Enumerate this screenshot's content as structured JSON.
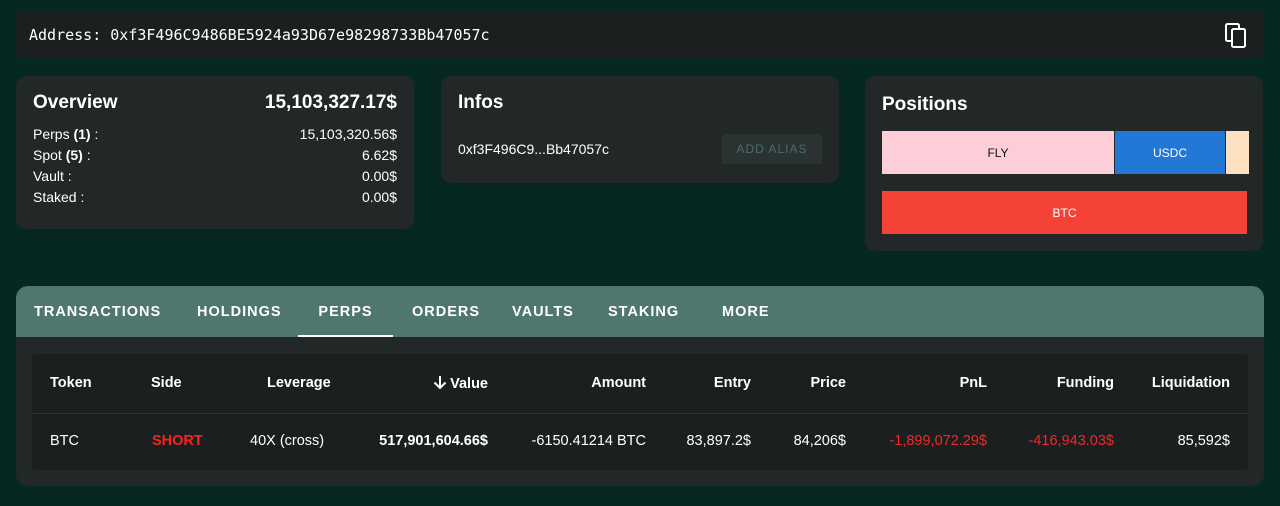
{
  "address": {
    "label": "Address:",
    "value": "0xf3F496C9486BE5924a93D67e98298733Bb47057c",
    "copy_icon": "copy-icon"
  },
  "overview": {
    "title": "Overview",
    "total": "15,103,327.17$",
    "rows": [
      {
        "label": "Perps",
        "count": "(1)",
        "suffix": " :",
        "value": "15,103,320.56$"
      },
      {
        "label": "Spot",
        "count": "(5)",
        "suffix": " :",
        "value": "6.62$"
      },
      {
        "label": "Vault :",
        "value": "0.00$"
      },
      {
        "label": "Staked :",
        "value": "0.00$"
      }
    ]
  },
  "infos": {
    "title": "Infos",
    "short_address": "0xf3F496C9...Bb47057c",
    "add_alias_label": "ADD ALIAS"
  },
  "positions": {
    "title": "Positions",
    "spot_segments": [
      {
        "label": "FLY",
        "color": "#fdcdd8"
      },
      {
        "label": "USDC",
        "color": "#2378d6"
      },
      {
        "label": "",
        "color": "#fde0c0"
      }
    ],
    "perp_segments": [
      {
        "label": "BTC",
        "color": "#f44336"
      }
    ]
  },
  "tabs": [
    {
      "label": "TRANSACTIONS",
      "active": false
    },
    {
      "label": "HOLDINGS",
      "active": false
    },
    {
      "label": "PERPS",
      "active": true
    },
    {
      "label": "ORDERS",
      "active": false
    },
    {
      "label": "VAULTS",
      "active": false
    },
    {
      "label": "STAKING",
      "active": false
    },
    {
      "label": "MORE",
      "active": false
    }
  ],
  "table": {
    "sort_icon": "arrow-down-icon",
    "columns": [
      "Token",
      "Side",
      "Leverage",
      "Value",
      "Amount",
      "Entry",
      "Price",
      "PnL",
      "Funding",
      "Liquidation"
    ],
    "rows": [
      {
        "token": "BTC",
        "side": "SHORT",
        "leverage": "40X (cross)",
        "value": "517,901,604.66$",
        "amount": "-6150.41214 BTC",
        "entry": "83,897.2$",
        "price": "84,206$",
        "pnl": "-1,899,072.29$",
        "funding": "-416,943.03$",
        "liquidation": "85,592$"
      }
    ]
  },
  "colors": {
    "background": "#072723",
    "card": "#222828",
    "tab_bar": "#4f766f",
    "negative": "#f02828",
    "short": "#ff2020"
  }
}
